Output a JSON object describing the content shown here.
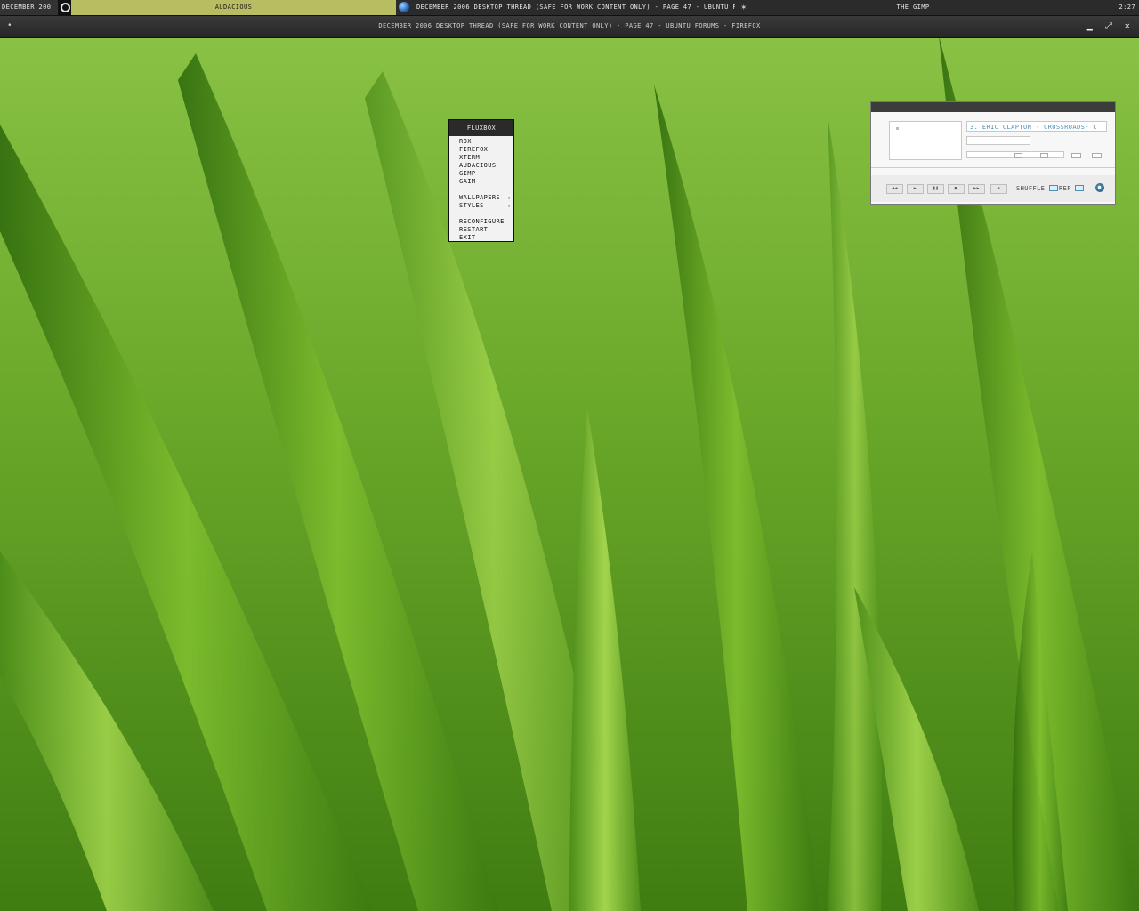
{
  "taskbar": {
    "workspace_label": "December 200",
    "active_task": "Audacious",
    "firefox_task": "December 2006 Desktop Thread (Safe for work content only) - Page 47 - Ubuntu F",
    "gimp_task": "The GIMP",
    "clock": "2:27"
  },
  "window": {
    "title": "December 2006 Desktop Thread (Safe for work content only) - Page 47 - Ubuntu Forums - Firefox",
    "menu_glyph": "•",
    "minimize_glyph": "▁",
    "maximize_glyph": "⤢",
    "close_glyph": "✕"
  },
  "fluxbox_menu": {
    "title": "fluxbox",
    "items": [
      {
        "label": "Rox"
      },
      {
        "label": "Firefox"
      },
      {
        "label": "xterm"
      },
      {
        "label": "Audacious"
      },
      {
        "label": "GIMP"
      },
      {
        "label": "Gaim"
      },
      {
        "label": "Wallpapers",
        "submenu_arrow": "▸"
      },
      {
        "label": "Styles",
        "submenu_arrow": "▸"
      },
      {
        "label": "Reconfigure"
      },
      {
        "label": "Restart"
      },
      {
        "label": "Exit"
      }
    ]
  },
  "audacious": {
    "track_title": "3. Eric Clapton - Crossroads- C",
    "controls": {
      "previous": "◀◀",
      "play": "▶",
      "pause": "❚❚",
      "stop": "■",
      "next": "▶▶",
      "eject": "⏏"
    },
    "shuffle_label": "Shuffle",
    "repeat_label": "Rep"
  },
  "colors": {
    "taskbar_bg": "#2b2b2b",
    "active_task_bg": "#b8bd62",
    "player_accent": "#4a8fb8",
    "wallpaper_green": "#5d9a1c"
  },
  "icons": {
    "taskbar_app_icon": "ring-icon",
    "firefox_icon": "globe-icon",
    "gimp_icon": "wilber-icon",
    "player_logo": "audacious-logo-icon"
  }
}
